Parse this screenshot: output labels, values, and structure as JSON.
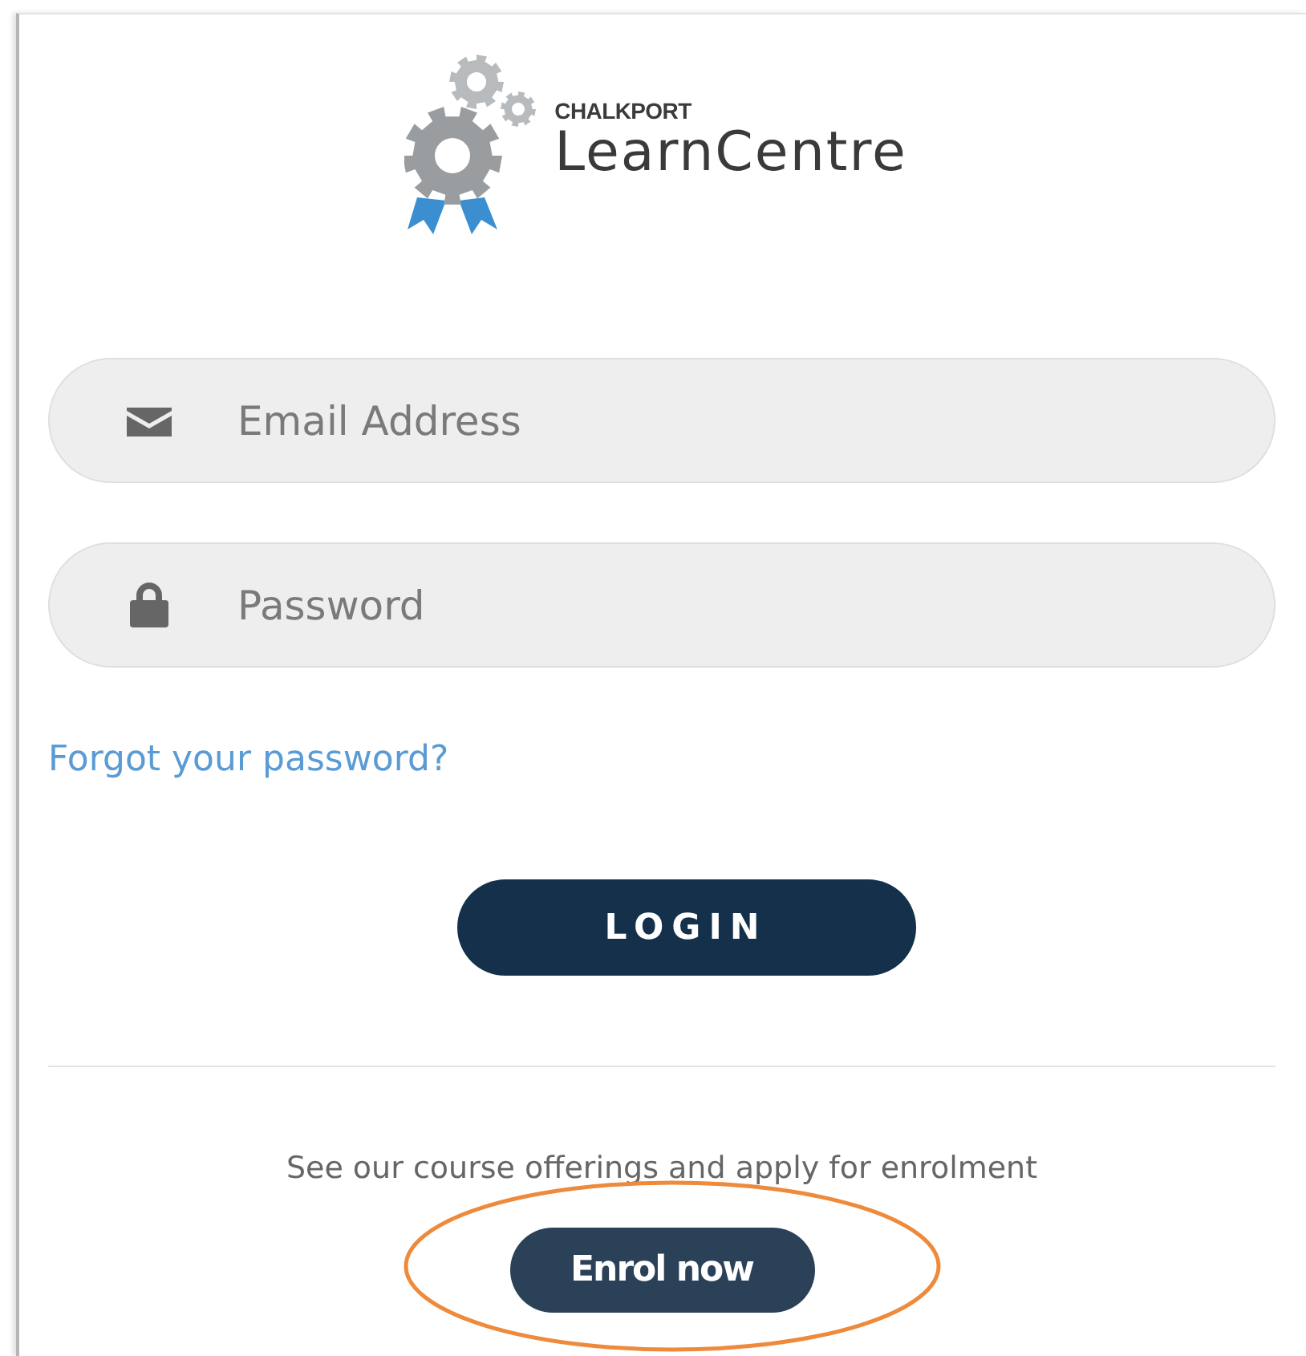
{
  "logo": {
    "brand": "CHALKPORT",
    "product": "LearnCentre"
  },
  "fields": [
    {
      "kind": "email",
      "placeholder": "Email Address"
    },
    {
      "kind": "password",
      "placeholder": "Password"
    }
  ],
  "forgot_link": "Forgot your password?",
  "login_button": "LOGIN",
  "enrol": {
    "text": "See our course offerings and apply for enrolment",
    "button": "Enrol now",
    "highlighted": true
  }
}
